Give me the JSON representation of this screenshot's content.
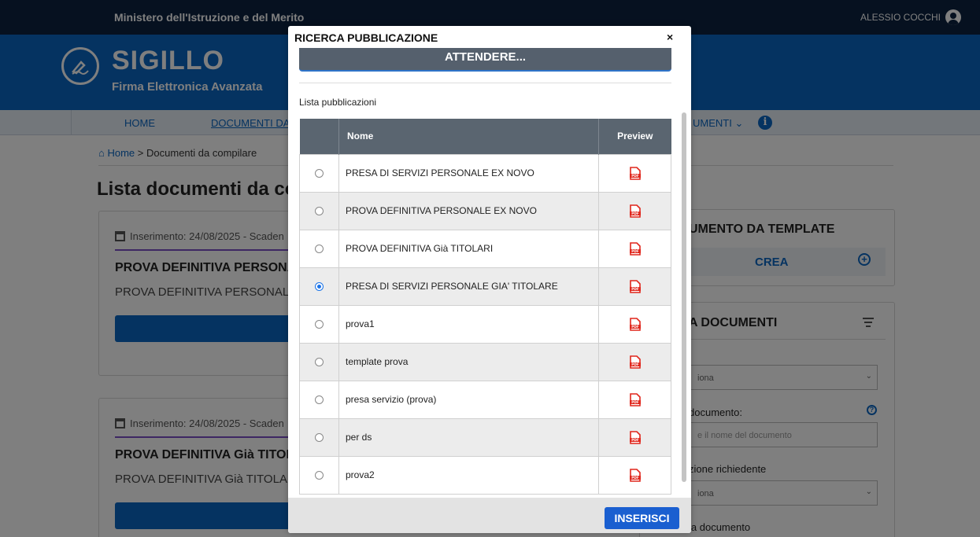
{
  "topbar": {
    "ministry": "Ministero dell'Istruzione e del Merito",
    "user": "ALESSIO COCCHI"
  },
  "brand": {
    "name": "SIGILLO",
    "subtitle": "Firma Elettronica Avanzata"
  },
  "nav": {
    "home": "HOME",
    "documents": "DOCUMENTI DA C",
    "documents2": "UMENTI ⌄"
  },
  "breadcrumb": {
    "home": "Home",
    "separator": ">",
    "current": "Documenti da compilare"
  },
  "page": {
    "title": "Lista documenti da com"
  },
  "cards": [
    {
      "meta": "Inserimento: 24/08/2025 - Scaden",
      "title": "PROVA DEFINITIVA PERSONA",
      "desc": "PROVA DEFINITIVA PERSONALE E"
    },
    {
      "meta": "Inserimento: 24/08/2025 - Scaden",
      "title": "PROVA DEFINITIVA Già TITOL",
      "desc": "PROVA DEFINITIVA Già TITOLARI"
    }
  ],
  "side_template": {
    "title": "UMENTO DA TEMPLATE",
    "create": "CREA"
  },
  "side_filter": {
    "title": "A DOCUMENTI",
    "select1": "iona",
    "doc_label": "documento:",
    "doc_placeholder": "e il nome del documento",
    "req_label": "zione richiedente",
    "select2": "iona",
    "tipo_label": "ia documento"
  },
  "modal": {
    "title": "RICERCA PUBBLICAZIONE",
    "close": "×",
    "wait_button": "ATTENDERE...",
    "list_label": "Lista pubblicazioni",
    "columns": {
      "name": "Nome",
      "preview": "Preview"
    },
    "rows": [
      {
        "name": "PRESA DI SERVIZI PERSONALE EX NOVO",
        "selected": false
      },
      {
        "name": "PROVA DEFINITIVA PERSONALE EX NOVO",
        "selected": false
      },
      {
        "name": "PROVA DEFINITIVA Già TITOLARI",
        "selected": false
      },
      {
        "name": "PRESA DI SERVIZI PERSONALE GIA' TITOLARE",
        "selected": true
      },
      {
        "name": "prova1",
        "selected": false
      },
      {
        "name": "template prova",
        "selected": false
      },
      {
        "name": "presa servizio (prova)",
        "selected": false
      },
      {
        "name": "per ds",
        "selected": false
      },
      {
        "name": "prova2",
        "selected": false
      }
    ],
    "insert_button": "INSERISCI"
  },
  "colors": {
    "navy": "#0c2340",
    "brand_blue": "#0a66c2",
    "header_gray": "#5a6570",
    "pdf_red": "#e0261c",
    "insert_blue": "#1a5fd0"
  },
  "icons": {
    "user": "account-circle-icon",
    "logo": "pen-signature-icon",
    "info": "info-icon",
    "home": "home-icon",
    "calendar": "calendar-icon",
    "add": "plus-circle-icon",
    "filter": "filter-icon",
    "help": "question-icon",
    "pdf": "pdf-file-icon"
  }
}
